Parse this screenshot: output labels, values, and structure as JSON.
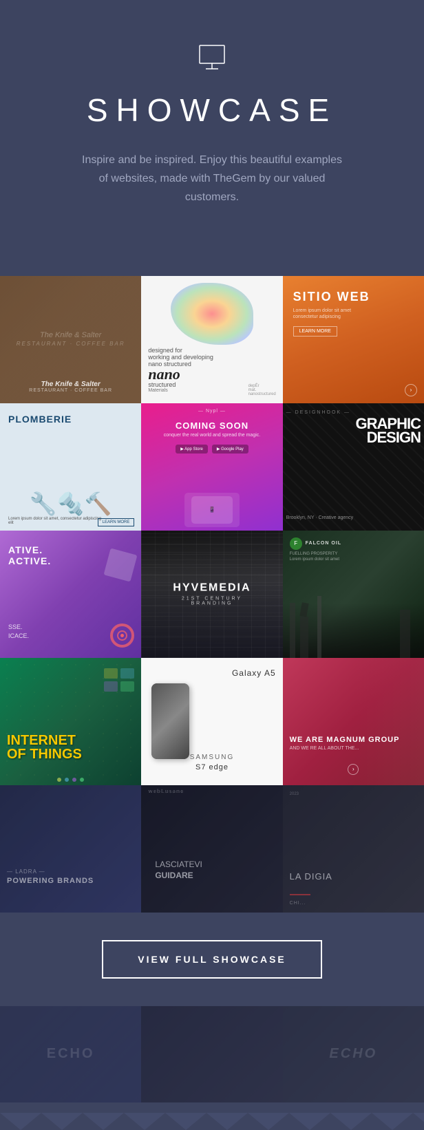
{
  "header": {
    "icon_label": "presentation-icon",
    "title": "SHOWCASE",
    "description": "Inspire and be inspired. Enjoy this beautiful examples of websites, made with TheGem by our valued customers."
  },
  "gallery": {
    "rows": [
      {
        "items": [
          {
            "id": 1,
            "label": "The Knife & Salter",
            "theme": "vintage",
            "alt": "Vintage website screenshot"
          },
          {
            "id": 2,
            "label": "nano structured materials",
            "theme": "white",
            "alt": "Nano materials website screenshot"
          },
          {
            "id": 3,
            "label": "SITIO WEB",
            "theme": "orange",
            "alt": "Sitio web screenshot"
          }
        ]
      },
      {
        "items": [
          {
            "id": 4,
            "label": "PLOMBERIE",
            "theme": "light-blue",
            "alt": "Plomberie website screenshot"
          },
          {
            "id": 5,
            "label": "COMING SOON",
            "theme": "pink-purple",
            "alt": "Coming soon screenshot"
          },
          {
            "id": 6,
            "label": "GRAPHIC DESIGN",
            "theme": "dark",
            "alt": "Graphic design screenshot"
          }
        ]
      },
      {
        "items": [
          {
            "id": 7,
            "label": "CREATIVE. ACTIVE.",
            "theme": "purple",
            "alt": "Creative website screenshot"
          },
          {
            "id": 8,
            "label": "HYVEMEDIA",
            "theme": "buildings",
            "alt": "Hyvemedia screenshot"
          },
          {
            "id": 9,
            "label": "FALCON OIL",
            "theme": "dark-green",
            "alt": "Falcon oil screenshot"
          }
        ]
      },
      {
        "items": [
          {
            "id": 10,
            "label": "INTERNET OF THINGS",
            "theme": "teal",
            "alt": "Internet of things screenshot"
          },
          {
            "id": 11,
            "label": "Galaxy A5 / S7 edge",
            "theme": "samsung",
            "alt": "Samsung website screenshot"
          },
          {
            "id": 12,
            "label": "WE ARE MAGNUM GROUP",
            "theme": "dark-red",
            "alt": "Magnum group screenshot"
          }
        ]
      },
      {
        "items": [
          {
            "id": 13,
            "label": "POWERING BRANDS",
            "theme": "dark-blue",
            "alt": "Powering brands screenshot"
          },
          {
            "id": 14,
            "label": "LASCIATEVI GUIDARE",
            "theme": "dark-car",
            "alt": "Lasciatevi guidare screenshot"
          },
          {
            "id": 15,
            "label": "LA DIGIA",
            "theme": "dark-minimal",
            "alt": "La Digia screenshot"
          }
        ]
      }
    ]
  },
  "cta": {
    "button_label": "VIEW FULL SHOWCASE"
  },
  "bottom_decorative": {
    "items": [
      {
        "id": 1,
        "label": "Echo"
      },
      {
        "id": 2,
        "label": ""
      },
      {
        "id": 3,
        "label": "Echo"
      }
    ]
  },
  "colors": {
    "background": "#3d4460",
    "title": "#ffffff",
    "description": "#a0a7c0",
    "button_border": "#ffffff",
    "button_text": "#ffffff"
  }
}
